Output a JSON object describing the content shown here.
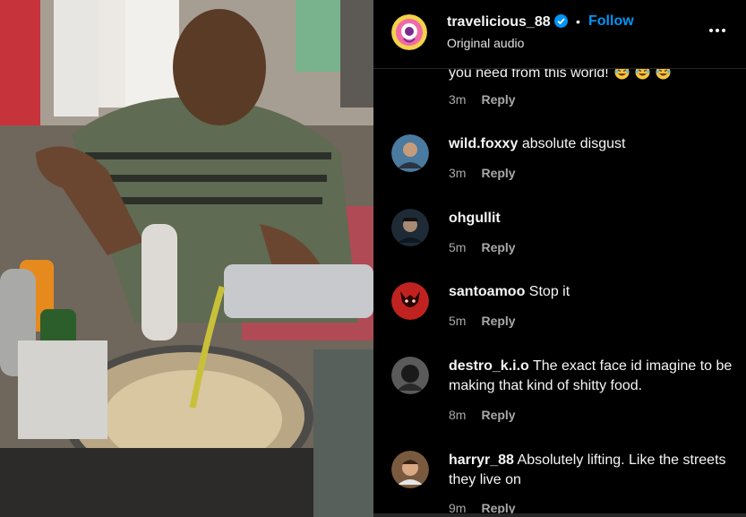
{
  "header": {
    "username": "travelicious_88",
    "separator": "•",
    "follow_label": "Follow",
    "audio_label": "Original audio",
    "icons": {
      "verified": "verified-badge-icon",
      "more": "more-options-icon"
    }
  },
  "comments": [
    {
      "username": "",
      "text": "you need from this world!",
      "time": "3m",
      "reply": "Reply",
      "emoji": [
        "laughing-emoji",
        "laughing-emoji",
        "laughing-emoji"
      ]
    },
    {
      "username": "wild.foxxy",
      "text": "absolute disgust",
      "time": "3m",
      "reply": "Reply"
    },
    {
      "username": "ohgullit",
      "text": "",
      "time": "5m",
      "reply": "Reply"
    },
    {
      "username": "santoamoo",
      "text": "Stop it",
      "time": "5m",
      "reply": "Reply"
    },
    {
      "username": "destro_k.i.o",
      "text": "The exact face id imagine to be making that kind of shitty food.",
      "time": "8m",
      "reply": "Reply"
    },
    {
      "username": "harryr_88",
      "text": "Absolutely lifting. Like the streets they live on",
      "time": "9m",
      "reply": "Reply"
    }
  ],
  "colors": {
    "accent": "#0095f6",
    "background": "#000000",
    "muted": "#a8a8a8"
  }
}
